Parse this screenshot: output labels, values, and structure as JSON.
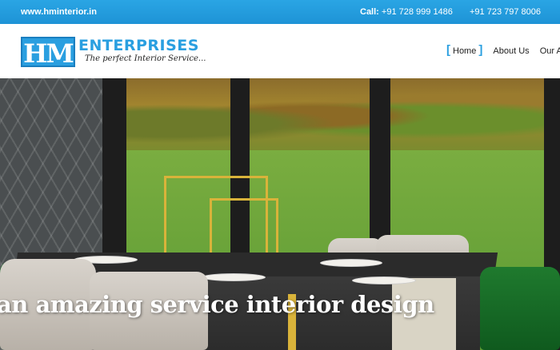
{
  "topbar": {
    "website": "www.hminterior.in",
    "call_label": "Call:",
    "phone1": "+91 728 999 1486",
    "phone2": "+91 723 797 8006",
    "bg_color": "#1e93d6"
  },
  "logo": {
    "mark": "HM",
    "name": "ENTERPRISES",
    "tagline": "The perfect Interior Service...",
    "brand_color": "#2a9fe0"
  },
  "nav": {
    "items": [
      {
        "label": "Home",
        "active": true
      },
      {
        "label": "About Us",
        "active": false
      },
      {
        "label": "Our Ai",
        "active": false
      }
    ]
  },
  "hero": {
    "headline": "an amazing service interior design"
  }
}
